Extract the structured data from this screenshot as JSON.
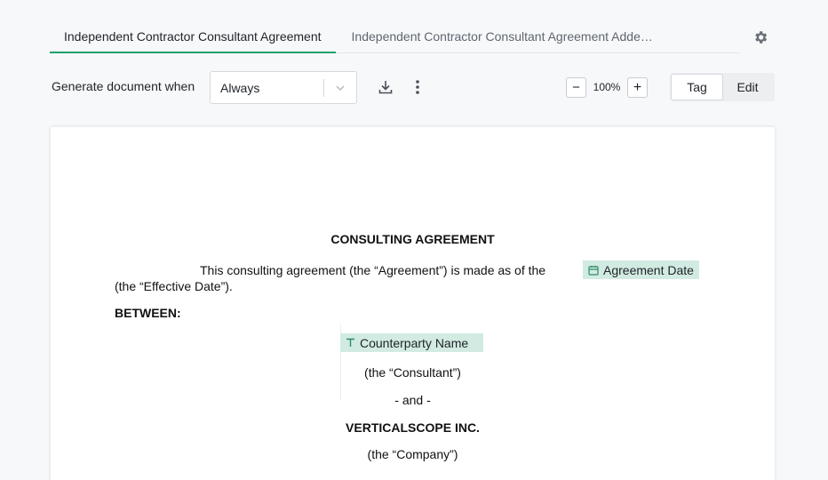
{
  "tabs": [
    {
      "label": "Independent Contractor Consultant Agreement",
      "active": true
    },
    {
      "label": "Independent Contractor Consultant Agreement Addendum",
      "active": false
    }
  ],
  "toolbar": {
    "generate_label": "Generate document when",
    "generate_value": "Always",
    "zoom": "100%",
    "zoom_minus": "−",
    "zoom_plus": "+",
    "mode_tag": "Tag",
    "mode_edit": "Edit",
    "active_mode": "Tag"
  },
  "icons": {
    "settings": "gear-icon",
    "download": "download-icon",
    "more": "more-vertical-icon",
    "chevron": "chevron-down-icon",
    "date_tag": "calendar-icon",
    "text_tag": "text-type-icon"
  },
  "colors": {
    "accent": "#1aa06d",
    "tag_bg": "#d2ebe2"
  },
  "document": {
    "title": "CONSULTING AGREEMENT",
    "intro_text": "This consulting agreement (the “Agreement”) is made as of the",
    "date_tag": "Agreement Date",
    "effective_text": "(the “Effective Date”).",
    "between": "BETWEEN:",
    "counterparty_tag": "Counterparty Name",
    "consultant": "(the “Consultant”)",
    "and": "- and -",
    "company_name": "VERTICALSCOPE INC.",
    "company": "(the “Company”)"
  }
}
